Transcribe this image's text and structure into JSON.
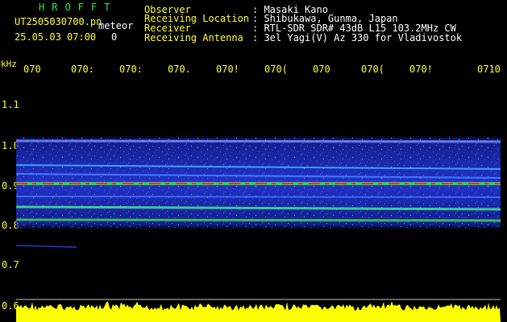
{
  "header": {
    "logo_text": "HROFFT",
    "filename": "UT2505030700.pn",
    "meteor_label": "meteor",
    "date_time": "25.05.03 07:00",
    "meteor_count": "0",
    "info_labels": [
      "Observer",
      "Receiving Location",
      "Receiver",
      "Receiving Antenna"
    ],
    "info_values": [
      ": Masaki Kano",
      ": Shibukawa, Gunma, Japan",
      ": RTL-SDR SDR# 43dB L15 103.2MHz CW",
      ": 3el Yagi(V) Az 330 for Vladivostok"
    ]
  },
  "axes": {
    "freq_unit": "kHz",
    "freq_ticks": [
      "1.1",
      "1.0",
      "0.9",
      "0.8",
      "0.7",
      "0.6"
    ],
    "time_ticks": [
      "070",
      "070:",
      "070:",
      "070.",
      "070!",
      "070(",
      "070",
      "070(",
      "070!",
      "0710"
    ]
  },
  "colors": {
    "background": "#000000",
    "text_yellow": "#ffff33",
    "text_white": "#ffffff",
    "text_green": "#39e639",
    "noise_blue": "#1e2fd0",
    "signal_red": "#ff3030",
    "signal_green": "#40e040",
    "amplitude_yellow": "#ffff00"
  }
}
